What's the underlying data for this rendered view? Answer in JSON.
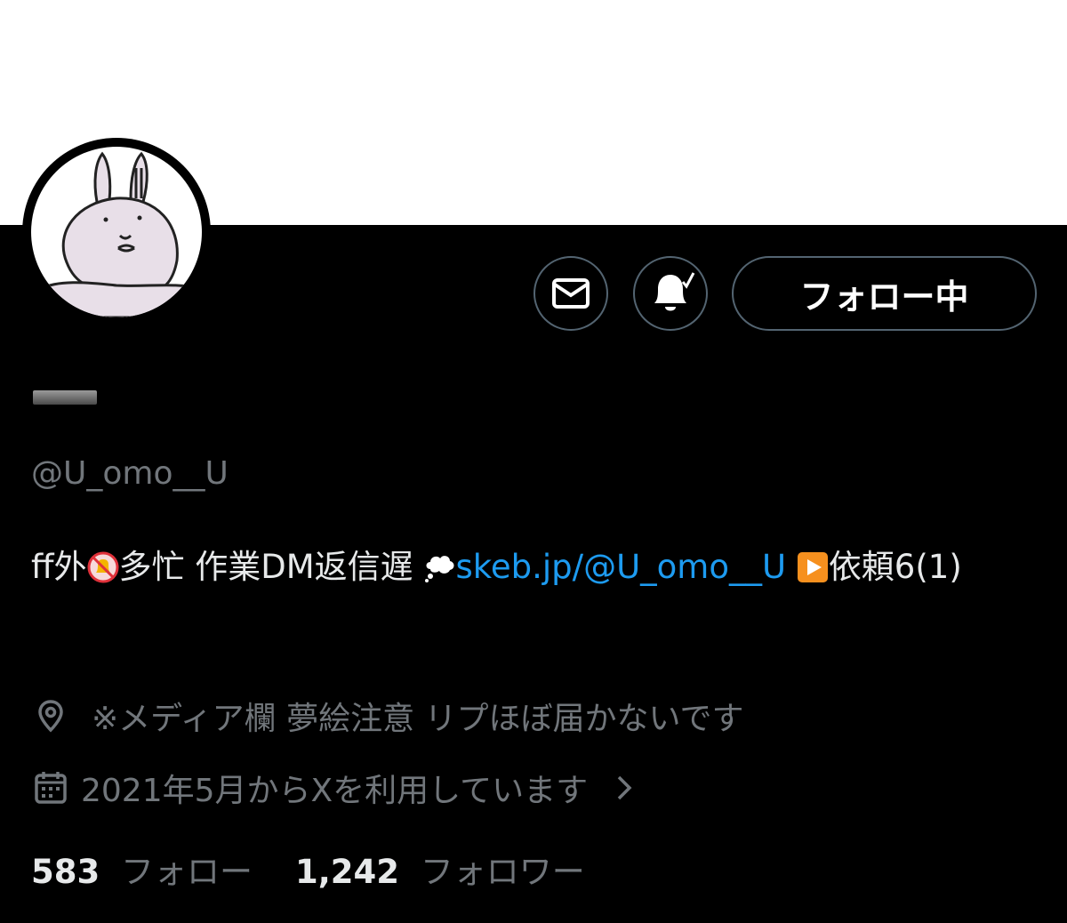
{
  "profile": {
    "handle": "@U_omo__U",
    "bio": {
      "part1": "ff外",
      "part2": "多忙 作業DM返信遅 ",
      "link": "skeb.jp/@U_omo__U",
      "part3": "依頼6(1)"
    },
    "location": "※メディア欄 夢絵注意 リプほぼ届かないです",
    "joined": "2021年5月からXを利用しています"
  },
  "actions": {
    "follow_label": "フォロー中"
  },
  "stats": {
    "following_count": "583",
    "following_label": "フォロー",
    "followers_count": "1,242",
    "followers_label": "フォロワー"
  },
  "icons": {
    "message": "envelope-icon",
    "notify": "bell-check-icon",
    "location": "location-pin-icon",
    "calendar": "calendar-icon",
    "chevron": "chevron-right-icon",
    "no_bell": "no-bell-emoji",
    "thought": "thought-balloon-emoji",
    "play": "play-button-emoji"
  },
  "colors": {
    "background": "#000000",
    "banner": "#ffffff",
    "link": "#1d9bf0",
    "secondary_text": "#71767b",
    "border": "#536471"
  }
}
